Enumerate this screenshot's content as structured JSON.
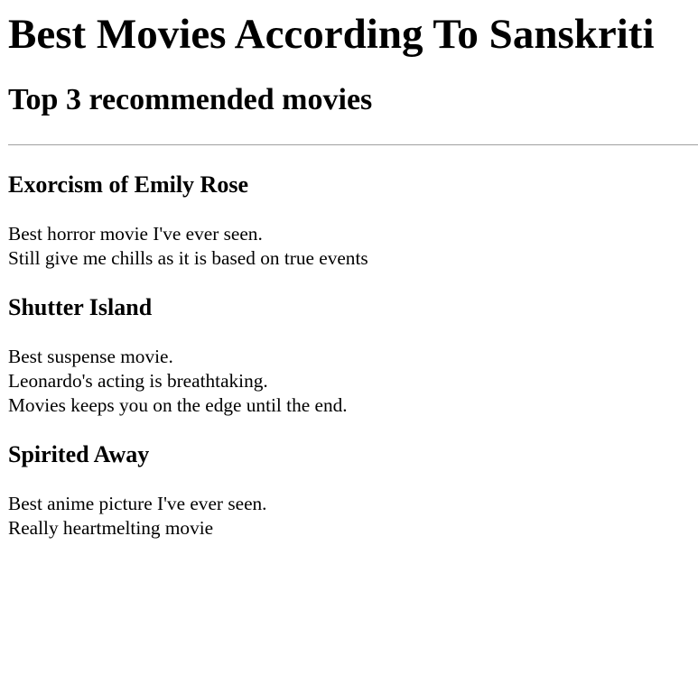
{
  "page": {
    "title": "Best Movies According To Sanskriti",
    "subtitle": "Top 3 recommended movies"
  },
  "movies": [
    {
      "title": "Exorcism of Emily Rose",
      "lines": [
        "Best horror movie I've ever seen.",
        "Still give me chills as it is based on true events"
      ]
    },
    {
      "title": "Shutter Island",
      "lines": [
        "Best suspense movie.",
        "Leonardo's acting is breathtaking.",
        "Movies keeps you on the edge until the end."
      ]
    },
    {
      "title": "Spirited Away",
      "lines": [
        "Best anime picture I've ever seen.",
        "Really heartmelting movie"
      ]
    }
  ]
}
